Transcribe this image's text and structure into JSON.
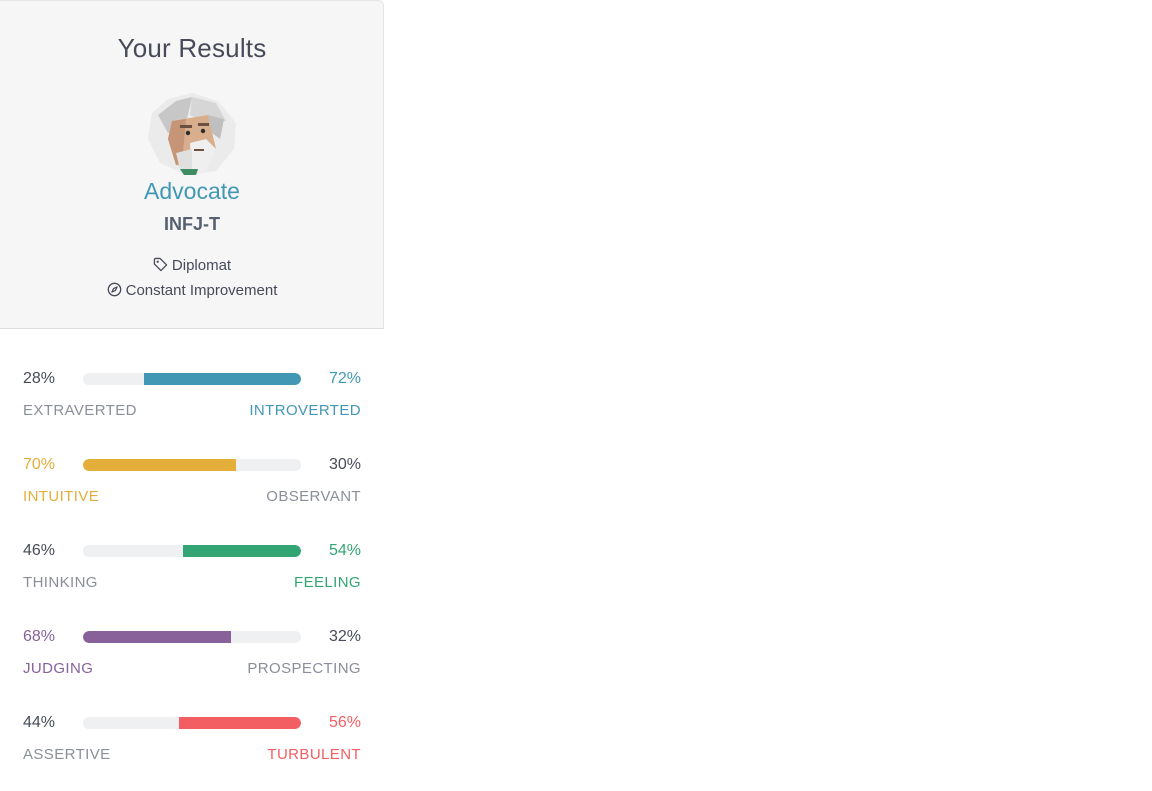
{
  "title": "Your Results",
  "type_name": "Advocate",
  "type_code": "INFJ-T",
  "role": {
    "icon": "tag-icon",
    "label": "Diplomat"
  },
  "strategy": {
    "icon": "compass-icon",
    "label": "Constant Improvement"
  },
  "traits": [
    {
      "left_label": "EXTRAVERTED",
      "left_pct": "28%",
      "right_label": "INTROVERTED",
      "right_pct": "72%",
      "dominant": "right",
      "dominant_value": 0.72,
      "color": "#4298b4"
    },
    {
      "left_label": "INTUITIVE",
      "left_pct": "70%",
      "right_label": "OBSERVANT",
      "right_pct": "30%",
      "dominant": "left",
      "dominant_value": 0.7,
      "color": "#e4ae3a"
    },
    {
      "left_label": "THINKING",
      "left_pct": "46%",
      "right_label": "FEELING",
      "right_pct": "54%",
      "dominant": "right",
      "dominant_value": 0.54,
      "color": "#33a474"
    },
    {
      "left_label": "JUDGING",
      "left_pct": "68%",
      "right_label": "PROSPECTING",
      "right_pct": "32%",
      "dominant": "left",
      "dominant_value": 0.68,
      "color": "#88619a"
    },
    {
      "left_label": "ASSERTIVE",
      "left_pct": "44%",
      "right_label": "TURBULENT",
      "right_pct": "56%",
      "dominant": "right",
      "dominant_value": 0.56,
      "color": "#f25e62"
    }
  ]
}
